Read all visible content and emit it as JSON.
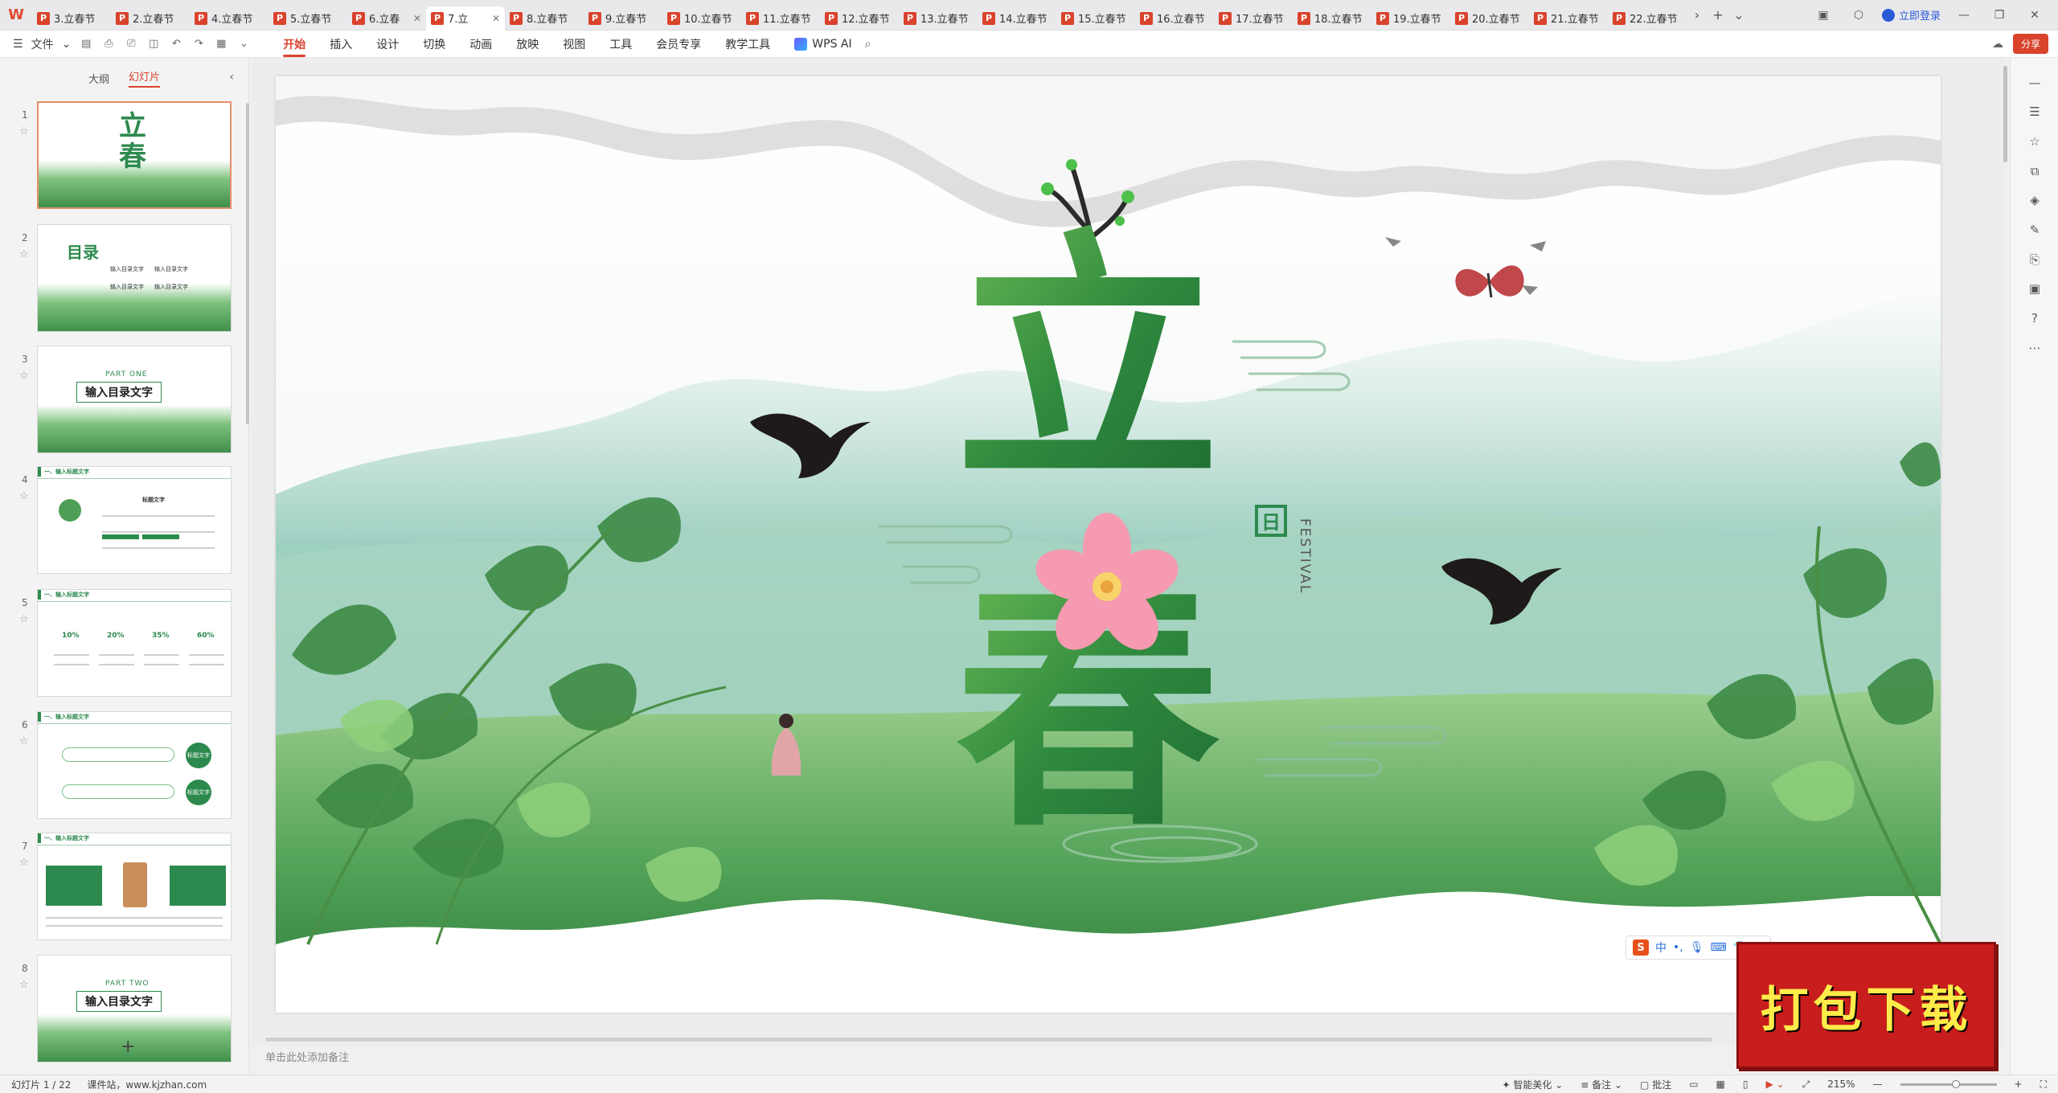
{
  "app": {
    "logo": "W"
  },
  "tabs": [
    {
      "label": "3.立春节"
    },
    {
      "label": "2.立春节"
    },
    {
      "label": "4.立春节"
    },
    {
      "label": "5.立春节"
    },
    {
      "label": "6.立春"
    },
    {
      "label": "7.立"
    },
    {
      "label": "8.立春节"
    },
    {
      "label": "9.立春节"
    },
    {
      "label": "10.立春节"
    },
    {
      "label": "11.立春节"
    },
    {
      "label": "12.立春节"
    },
    {
      "label": "13.立春节"
    },
    {
      "label": "14.立春节"
    },
    {
      "label": "15.立春节"
    },
    {
      "label": "16.立春节"
    },
    {
      "label": "17.立春节"
    },
    {
      "label": "18.立春节"
    },
    {
      "label": "19.立春节"
    },
    {
      "label": "20.立春节"
    },
    {
      "label": "21.立春节"
    },
    {
      "label": "22.立春节"
    }
  ],
  "tab_file_icon": "P",
  "header": {
    "login": "立即登录",
    "share": "分享"
  },
  "toolbar": {
    "file_menu": "文件",
    "menus": [
      "开始",
      "插入",
      "设计",
      "切换",
      "动画",
      "放映",
      "视图",
      "工具",
      "会员专享",
      "教学工具"
    ],
    "wps_ai": "WPS AI"
  },
  "panel": {
    "outline_tab": "大纲",
    "slides_tab": "幻灯片"
  },
  "thumbnails": [
    {
      "num": "1",
      "title": "立春"
    },
    {
      "num": "2",
      "title": "目录",
      "items": [
        "输入目录文字",
        "输入目录文字",
        "输入目录文字",
        "输入目录文字"
      ]
    },
    {
      "num": "3",
      "part": "PART ONE",
      "title": "输入目录文字"
    },
    {
      "num": "4",
      "title": "一、输入标题文字",
      "sub": "标题文字"
    },
    {
      "num": "5",
      "title": "一、输入标题文字",
      "percents": [
        "10%",
        "20%",
        "35%",
        "60%"
      ]
    },
    {
      "num": "6",
      "title": "一、输入标题文字",
      "badges": [
        "标题文字",
        "标题文字"
      ]
    },
    {
      "num": "7",
      "title": "一、输入标题文字"
    },
    {
      "num": "8",
      "part": "PART TWO",
      "title": "输入目录文字"
    }
  ],
  "slide": {
    "title_top": "立",
    "title_bottom": "春",
    "seal": "日",
    "festival": "FESTIVAL"
  },
  "notes_placeholder": "单击此处添加备注",
  "status": {
    "slide_count": "幻灯片 1 / 22",
    "site": "课件站，www.kjzhan.com",
    "beautify": "智能美化",
    "notes": "备注",
    "comments": "批注",
    "zoom": "215%",
    "zoom_value": 215
  },
  "ime": {
    "label": "中"
  },
  "download_banner": "打包下载",
  "colors": {
    "accent": "#d9432c",
    "slide_green": "#2d8a4e",
    "banner_red": "#c81d1d",
    "banner_text": "#ffec4a"
  }
}
